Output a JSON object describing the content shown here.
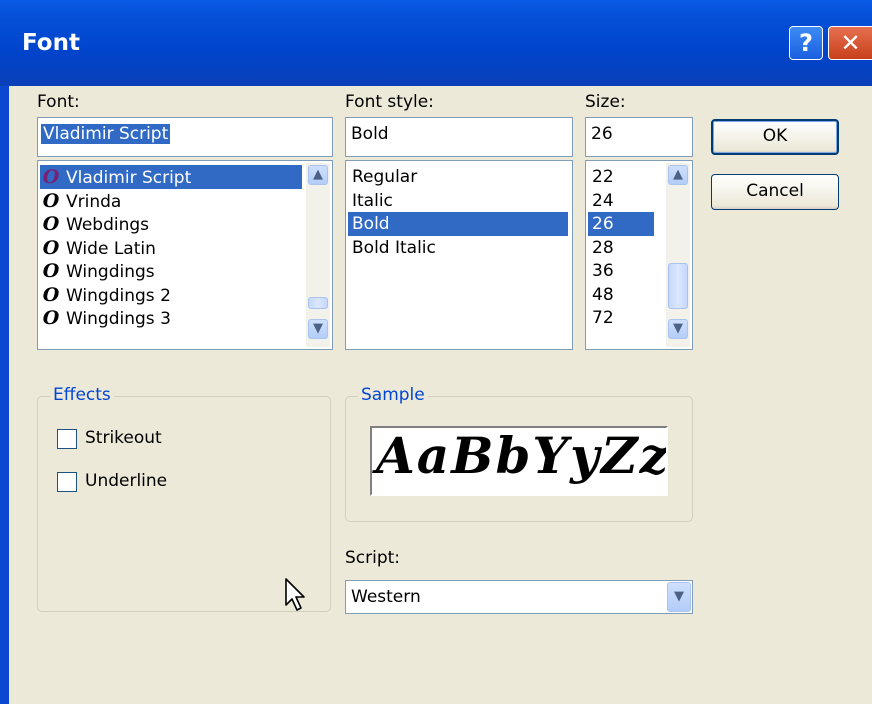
{
  "window": {
    "title": "Font"
  },
  "titlebar": {
    "help_label": "?",
    "close_label": "✕"
  },
  "font": {
    "label": "Font:",
    "value": "Vladimir Script",
    "items": [
      "Vladimir Script",
      "Vrinda",
      "Webdings",
      "Wide Latin",
      "Wingdings",
      "Wingdings 2",
      "Wingdings 3"
    ],
    "selected": "Vladimir Script",
    "icon_glyph": "O"
  },
  "style": {
    "label": "Font style:",
    "value": "Bold",
    "items": [
      "Regular",
      "Italic",
      "Bold",
      "Bold Italic"
    ],
    "selected": "Bold"
  },
  "size": {
    "label": "Size:",
    "value": "26",
    "items": [
      "22",
      "24",
      "26",
      "28",
      "36",
      "48",
      "72"
    ],
    "selected": "26"
  },
  "buttons": {
    "ok": "OK",
    "cancel": "Cancel"
  },
  "effects": {
    "label": "Effects",
    "strikeout": "Strikeout",
    "underline": "Underline",
    "strikeout_checked": false,
    "underline_checked": false
  },
  "sample": {
    "label": "Sample",
    "text": "AaBbYyZz"
  },
  "script": {
    "label": "Script:",
    "value": "Western"
  },
  "icons": {
    "scroll_up": "▲",
    "scroll_down": "▼",
    "combo": "▼"
  },
  "colors": {
    "titlebar": "#0044cc",
    "selection": "#316ac5",
    "dialog_bg": "#ece9d8",
    "truetype_icon": "#000000",
    "truetype_icon_selected": "#7a2070"
  }
}
